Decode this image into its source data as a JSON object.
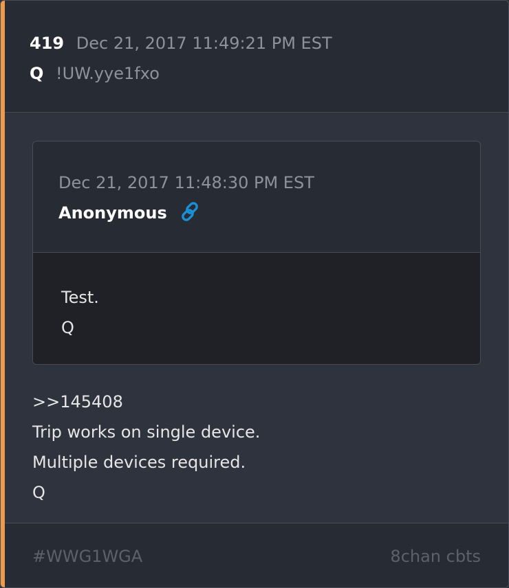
{
  "post": {
    "number": "419",
    "date": "Dec 21, 2017 11:49:21 PM EST",
    "author": "Q",
    "tripcode": "!UW.yye1fxo"
  },
  "quoted_post": {
    "date": "Dec 21, 2017 11:48:30 PM EST",
    "author": "Anonymous",
    "link_icon": "link-icon",
    "lines": [
      "Test.",
      "Q"
    ]
  },
  "message": {
    "lines": [
      ">>145408",
      "Trip works on single device.",
      "Multiple devices required.",
      "Q"
    ]
  },
  "footer": {
    "hashtag": "#WWG1WGA",
    "source": "8chan cbts"
  },
  "colors": {
    "accent": "#f0994a",
    "link": "#1a8fd6"
  }
}
